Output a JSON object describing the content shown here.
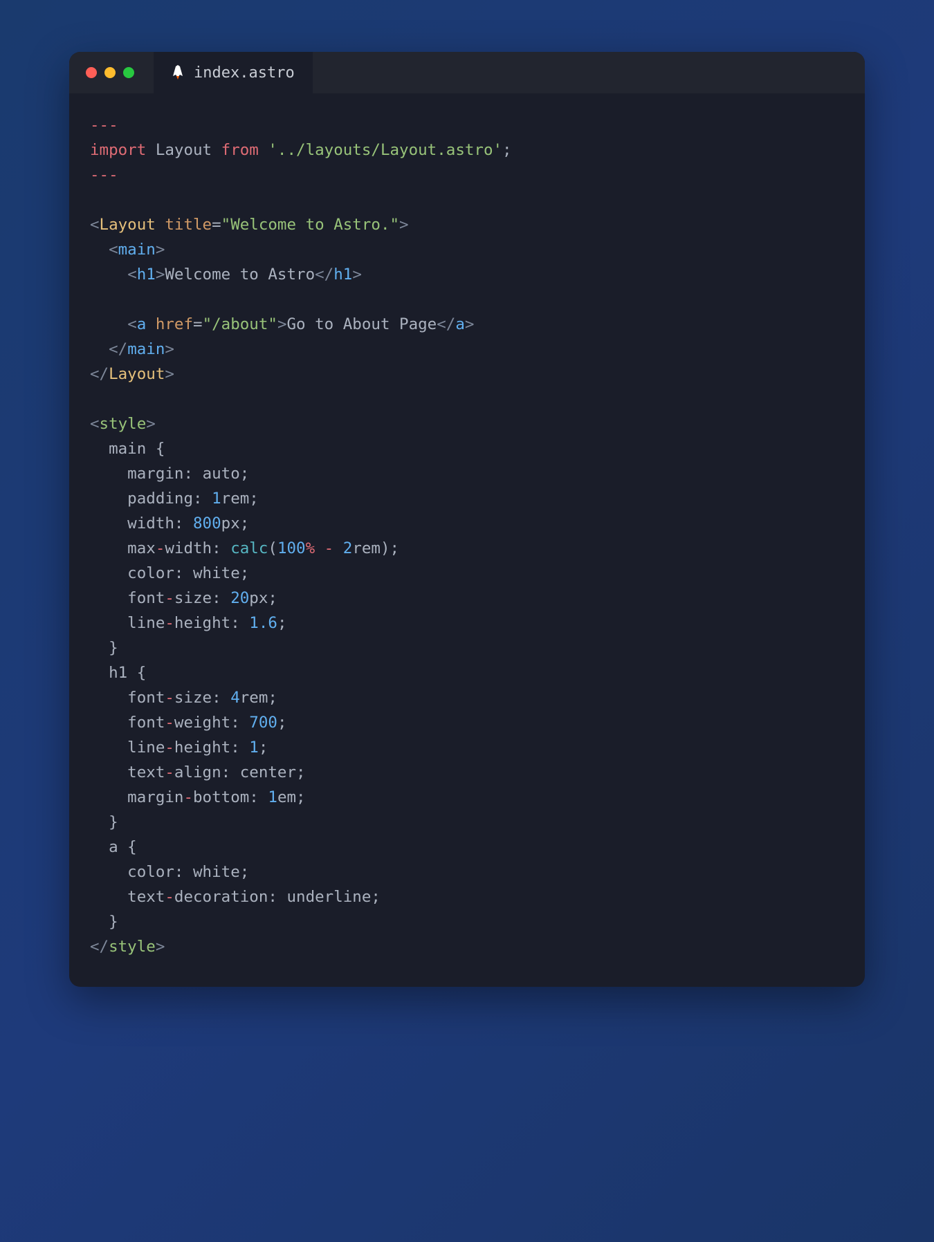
{
  "tab": {
    "filename": "index.astro"
  },
  "code": {
    "line1": "---",
    "line2_import": "import",
    "line2_layout": " Layout ",
    "line2_from": "from",
    "line2_path": " '../layouts/Layout.astro'",
    "line2_semi": ";",
    "line3": "---",
    "line5_open": "<",
    "line5_layout": "Layout",
    "line5_sp": " ",
    "line5_title": "title",
    "line5_eq": "=",
    "line5_val": "\"Welcome to Astro.\"",
    "line5_close": ">",
    "line6_indent": "  ",
    "line6_open": "<",
    "line6_main": "main",
    "line6_close": ">",
    "line7_indent": "    ",
    "line7_open": "<",
    "line7_h1": "h1",
    "line7_close": ">",
    "line7_text": "Welcome to Astro",
    "line7_open2": "</",
    "line7_close2": ">",
    "line9_indent": "    ",
    "line9_open": "<",
    "line9_a": "a",
    "line9_sp": " ",
    "line9_href": "href",
    "line9_eq": "=",
    "line9_val": "\"/about\"",
    "line9_close": ">",
    "line9_text": "Go to About Page",
    "line9_open2": "</",
    "line9_close2": ">",
    "line10_indent": "  ",
    "line10_open": "</",
    "line10_main": "main",
    "line10_close": ">",
    "line11_open": "</",
    "line11_layout": "Layout",
    "line11_close": ">",
    "line13_open": "<",
    "line13_style": "style",
    "line13_close": ">",
    "line14": "  main {",
    "line15_indent": "    margin",
    "line15_colon": ": ",
    "line15_val": "auto",
    "line15_semi": ";",
    "line16_indent": "    padding",
    "line16_colon": ": ",
    "line16_num": "1",
    "line16_unit": "rem",
    "line16_semi": ";",
    "line17_indent": "    width",
    "line17_colon": ": ",
    "line17_num": "800",
    "line17_unit": "px",
    "line17_semi": ";",
    "line18_indent": "    max",
    "line18_dash": "-",
    "line18_width": "width",
    "line18_colon": ": ",
    "line18_calc": "calc",
    "line18_paren": "(",
    "line18_100": "100",
    "line18_pct": "%",
    "line18_sp": " ",
    "line18_minus": "-",
    "line18_sp2": " ",
    "line18_2": "2",
    "line18_rem": "rem",
    "line18_paren2": ")",
    "line18_semi": ";",
    "line19_indent": "    color",
    "line19_colon": ": ",
    "line19_val": "white",
    "line19_semi": ";",
    "line20_indent": "    font",
    "line20_dash": "-",
    "line20_size": "size",
    "line20_colon": ": ",
    "line20_num": "20",
    "line20_unit": "px",
    "line20_semi": ";",
    "line21_indent": "    line",
    "line21_dash": "-",
    "line21_height": "height",
    "line21_colon": ": ",
    "line21_num": "1.6",
    "line21_semi": ";",
    "line22": "  }",
    "line23": "  h1 {",
    "line24_indent": "    font",
    "line24_dash": "-",
    "line24_size": "size",
    "line24_colon": ": ",
    "line24_num": "4",
    "line24_unit": "rem",
    "line24_semi": ";",
    "line25_indent": "    font",
    "line25_dash": "-",
    "line25_weight": "weight",
    "line25_colon": ": ",
    "line25_num": "700",
    "line25_semi": ";",
    "line26_indent": "    line",
    "line26_dash": "-",
    "line26_height": "height",
    "line26_colon": ": ",
    "line26_num": "1",
    "line26_semi": ";",
    "line27_indent": "    text",
    "line27_dash": "-",
    "line27_align": "align",
    "line27_colon": ": ",
    "line27_val": "center",
    "line27_semi": ";",
    "line28_indent": "    margin",
    "line28_dash": "-",
    "line28_bottom": "bottom",
    "line28_colon": ": ",
    "line28_num": "1",
    "line28_unit": "em",
    "line28_semi": ";",
    "line29": "  }",
    "line30": "  a {",
    "line31_indent": "    color",
    "line31_colon": ": ",
    "line31_val": "white",
    "line31_semi": ";",
    "line32_indent": "    text",
    "line32_dash": "-",
    "line32_deco": "decoration",
    "line32_colon": ": ",
    "line32_val": "underline",
    "line32_semi": ";",
    "line33": "  }",
    "line34_open": "</",
    "line34_style": "style",
    "line34_close": ">"
  }
}
